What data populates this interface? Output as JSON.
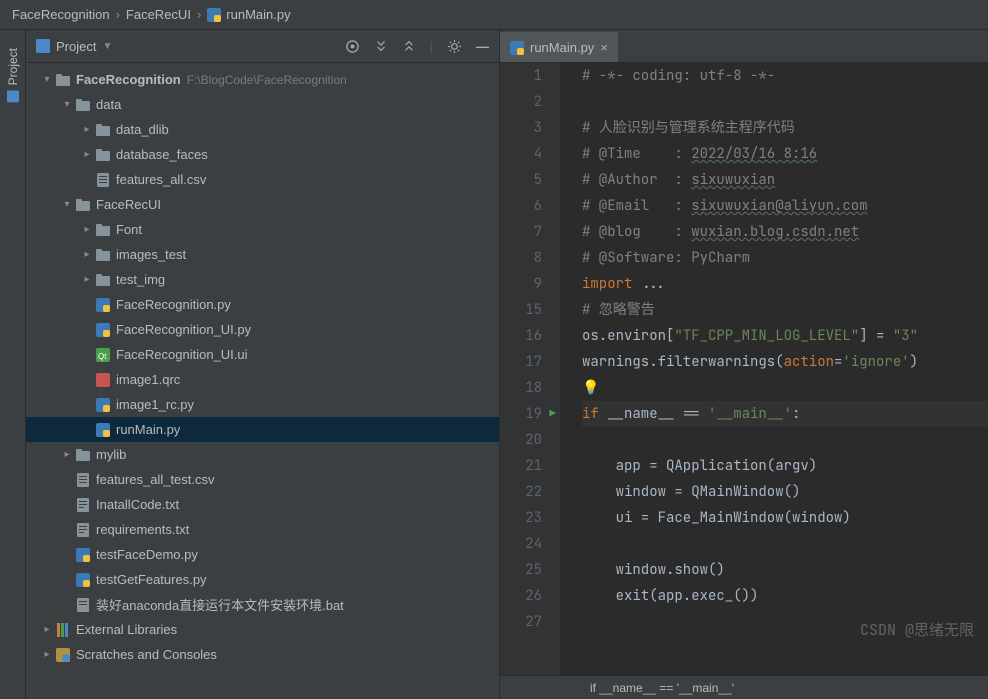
{
  "breadcrumb": {
    "root": "FaceRecognition",
    "mid": "FaceRecUI",
    "file": "runMain.py"
  },
  "sidebar": {
    "project_label": "Project"
  },
  "panel": {
    "title": "Project",
    "actions": {
      "target": "⊕",
      "collapse": "⇆",
      "expand": "÷",
      "settings": "⚙",
      "hide": "—"
    }
  },
  "tree": {
    "root": {
      "name": "FaceRecognition",
      "path": "F:\\BlogCode\\FaceRecognition"
    },
    "data": {
      "name": "data"
    },
    "data_dlib": {
      "name": "data_dlib"
    },
    "database_faces": {
      "name": "database_faces"
    },
    "features_csv": {
      "name": "features_all.csv"
    },
    "facerecui": {
      "name": "FaceRecUI"
    },
    "font": {
      "name": "Font"
    },
    "images_test": {
      "name": "images_test"
    },
    "test_img": {
      "name": "test_img"
    },
    "facerec_py": {
      "name": "FaceRecognition.py"
    },
    "facerec_ui_py": {
      "name": "FaceRecognition_UI.py"
    },
    "facerec_ui_ui": {
      "name": "FaceRecognition_UI.ui"
    },
    "image1_qrc": {
      "name": "image1.qrc"
    },
    "image1_rc_py": {
      "name": "image1_rc.py"
    },
    "runmain_py": {
      "name": "runMain.py"
    },
    "mylib": {
      "name": "mylib"
    },
    "features_test_csv": {
      "name": "features_all_test.csv"
    },
    "install_code": {
      "name": "InatallCode.txt"
    },
    "requirements": {
      "name": "requirements.txt"
    },
    "testfacedemo": {
      "name": "testFaceDemo.py"
    },
    "testgetfeatures": {
      "name": "testGetFeatures.py"
    },
    "anaconda_bat": {
      "name": "装好anaconda直接运行本文件安装环境.bat"
    },
    "extlib": {
      "name": "External Libraries"
    },
    "scratches": {
      "name": "Scratches and Consoles"
    }
  },
  "tab": {
    "name": "runMain.py"
  },
  "code": {
    "l1": "# -*- coding: utf-8 -*-",
    "l2": "",
    "l3": "# 人脸识别与管理系统主程序代码",
    "l4a": "# @Time    : ",
    "l4b": "2022/03/16 8:16",
    "l5a": "# @Author  : ",
    "l5b": "sixuwuxian",
    "l6a": "# @Email   : ",
    "l6b": "sixuwuxian@aliyun.com",
    "l7a": "# @blog    : ",
    "l7b": "wuxian.blog.csdn.net",
    "l8": "# @Software: PyCharm",
    "l9a": "import",
    "l9b": " ...",
    "l15": "# 忽略警告",
    "l16a": "os.environ[",
    "l16b": "\"TF_CPP_MIN_LOG_LEVEL\"",
    "l16c": "] = ",
    "l16d": "\"3\"",
    "l17a": "warnings.filterwarnings(",
    "l17b": "action",
    "l17c": "=",
    "l17d": "'ignore'",
    "l17e": ")",
    "l18": "💡",
    "l19a": "if",
    "l19b": " __name__ == ",
    "l19c": "'__main__'",
    "l19d": ":",
    "l21": "    app = QApplication(argv)",
    "l22": "    window = QMainWindow()",
    "l23": "    ui = Face_MainWindow(window)",
    "l25": "    window.show()",
    "l26a": "    exit(app.exec_())",
    "lines": [
      "1",
      "2",
      "3",
      "4",
      "5",
      "6",
      "7",
      "8",
      "9",
      "15",
      "16",
      "17",
      "18",
      "19",
      "20",
      "21",
      "22",
      "23",
      "24",
      "25",
      "26",
      "27"
    ]
  },
  "crumb": {
    "text": "if __name__ == '__main__'"
  },
  "watermark": "CSDN @思绪无限"
}
